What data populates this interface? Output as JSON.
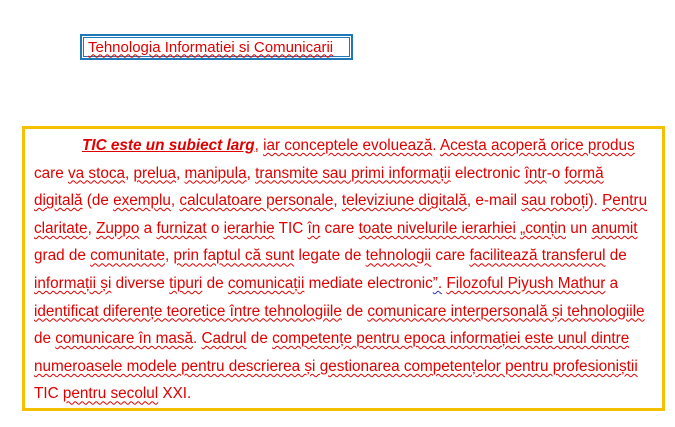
{
  "title": "Tehnologia Informatiei si Comunicarii",
  "paragraph": {
    "segments": [
      {
        "t": "TIC este un subiect larg",
        "s": "lead"
      },
      {
        "t": ", ",
        "s": ""
      },
      {
        "t": "iar conceptele evoluează",
        "s": "sp"
      },
      {
        "t": ". ",
        "s": ""
      },
      {
        "t": "Acesta acoperă orice produs",
        "s": "sp"
      },
      {
        "t": " care ",
        "s": ""
      },
      {
        "t": "va stoca",
        "s": "sp"
      },
      {
        "t": ", ",
        "s": ""
      },
      {
        "t": "prelua",
        "s": "sp"
      },
      {
        "t": ", ",
        "s": ""
      },
      {
        "t": "manipula",
        "s": "sp"
      },
      {
        "t": ", ",
        "s": ""
      },
      {
        "t": "transmite sau primi informații",
        "s": "sp"
      },
      {
        "t": " electronic ",
        "s": ""
      },
      {
        "t": "într",
        "s": "sp"
      },
      {
        "t": "-o ",
        "s": ""
      },
      {
        "t": "formă digitală",
        "s": "sp"
      },
      {
        "t": " (de ",
        "s": ""
      },
      {
        "t": "exemplu",
        "s": "sp"
      },
      {
        "t": ", ",
        "s": ""
      },
      {
        "t": "calculatoare personale",
        "s": "sp"
      },
      {
        "t": ", ",
        "s": ""
      },
      {
        "t": "televiziune digitală",
        "s": "sp"
      },
      {
        "t": ", e-mail ",
        "s": ""
      },
      {
        "t": "sau roboți",
        "s": "sp"
      },
      {
        "t": "). ",
        "s": ""
      },
      {
        "t": "Pentru claritate",
        "s": "sp"
      },
      {
        "t": ", ",
        "s": ""
      },
      {
        "t": "Zuppo",
        "s": "sp"
      },
      {
        "t": " a ",
        "s": ""
      },
      {
        "t": "furnizat",
        "s": "sp"
      },
      {
        "t": " o ",
        "s": ""
      },
      {
        "t": "ierarhie",
        "s": "sp"
      },
      {
        "t": " TIC ",
        "s": ""
      },
      {
        "t": "în",
        "s": "sp"
      },
      {
        "t": " care ",
        "s": ""
      },
      {
        "t": "toate nivelurile ierarhiei",
        "s": "sp"
      },
      {
        "t": " ",
        "s": ""
      },
      {
        "t": "„conțin",
        "s": "sp"
      },
      {
        "t": " un ",
        "s": ""
      },
      {
        "t": "anumit",
        "s": "sp"
      },
      {
        "t": " grad de ",
        "s": ""
      },
      {
        "t": "comunitate",
        "s": "sp"
      },
      {
        "t": ", ",
        "s": ""
      },
      {
        "t": "prin faptul că sunt",
        "s": "sp"
      },
      {
        "t": " legate de ",
        "s": ""
      },
      {
        "t": "tehnologii",
        "s": "sp"
      },
      {
        "t": " care ",
        "s": ""
      },
      {
        "t": "facilitează transferul",
        "s": "sp"
      },
      {
        "t": " de ",
        "s": ""
      },
      {
        "t": "informații și",
        "s": "sp"
      },
      {
        "t": " diverse ",
        "s": ""
      },
      {
        "t": "tipuri",
        "s": "sp"
      },
      {
        "t": " de ",
        "s": ""
      },
      {
        "t": "comunicații",
        "s": "sp"
      },
      {
        "t": " mediate electronic",
        "s": ""
      },
      {
        "t": "”.",
        "s": "gr"
      },
      {
        "t": " ",
        "s": ""
      },
      {
        "t": "Filozoful Piyush Mathur",
        "s": "sp"
      },
      {
        "t": " a ",
        "s": ""
      },
      {
        "t": "identificat diferențe teoretice între tehnologiile",
        "s": "sp"
      },
      {
        "t": " de ",
        "s": ""
      },
      {
        "t": "comunicare interpersonală și tehnologiile",
        "s": "sp"
      },
      {
        "t": " de ",
        "s": ""
      },
      {
        "t": "comunicare în masă",
        "s": "sp"
      },
      {
        "t": ". ",
        "s": ""
      },
      {
        "t": "Cadrul",
        "s": "sp"
      },
      {
        "t": " de ",
        "s": ""
      },
      {
        "t": "competențe pentru epoca informației este unul dintre numeroasele modele pentru descrierea și gestionarea competențelor pentru profesioniștii",
        "s": "sp"
      },
      {
        "t": " TIC ",
        "s": ""
      },
      {
        "t": "pentru secolul",
        "s": "sp"
      },
      {
        "t": " XXI.",
        "s": ""
      }
    ]
  },
  "colors": {
    "text": "#e00000",
    "title_border": "#1f78b8",
    "content_border": "#f5c000",
    "grammar_underline": "#3030c0"
  }
}
